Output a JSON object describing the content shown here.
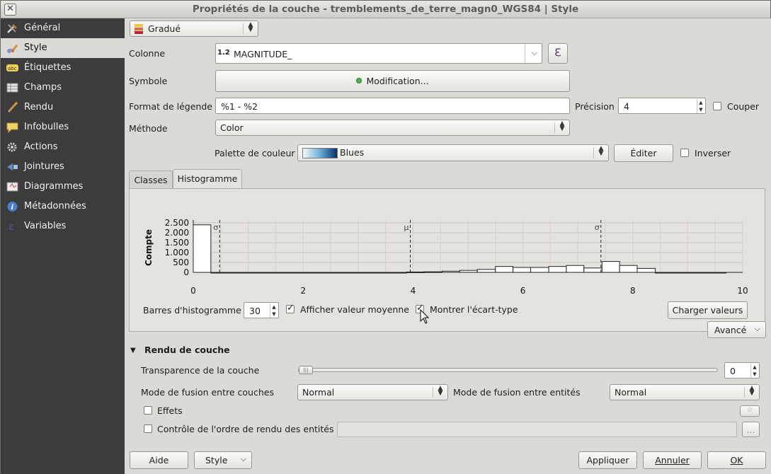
{
  "window": {
    "title": "Propriétés de la couche - tremblements_de_terre_magn0_WGS84 | Style"
  },
  "sidebar": {
    "items": [
      {
        "label": "Général",
        "icon": "tools-icon"
      },
      {
        "label": "Style",
        "icon": "paintbrush-icon",
        "active": true
      },
      {
        "label": "Étiquettes",
        "icon": "abc-label-icon"
      },
      {
        "label": "Champs",
        "icon": "table-icon"
      },
      {
        "label": "Rendu",
        "icon": "brush-icon"
      },
      {
        "label": "Infobulles",
        "icon": "speech-bubble-icon"
      },
      {
        "label": "Actions",
        "icon": "gear-icon"
      },
      {
        "label": "Jointures",
        "icon": "join-icon"
      },
      {
        "label": "Diagrammes",
        "icon": "diagram-icon"
      },
      {
        "label": "Métadonnées",
        "icon": "info-icon"
      },
      {
        "label": "Variables",
        "icon": "epsilon-icon"
      }
    ]
  },
  "renderer": {
    "value": "Gradué"
  },
  "column": {
    "label": "Colonne",
    "type_badge": "1.2",
    "value": "MAGNITUDE_",
    "expr_button": "ε"
  },
  "symbol": {
    "label": "Symbole",
    "button": "Modification..."
  },
  "legend_format": {
    "label": "Format de légende",
    "value": "%1 - %2"
  },
  "precision": {
    "label": "Précision",
    "value": "4"
  },
  "truncate": {
    "label": "Couper",
    "checked": false
  },
  "method": {
    "label": "Méthode",
    "value": "Color"
  },
  "color_ramp": {
    "label": "Palette de couleur",
    "value": "Blues",
    "edit_button": "Éditer",
    "invert_label": "Inverser",
    "invert_checked": false
  },
  "tabs": {
    "classes": "Classes",
    "histogram": "Histogramme",
    "active": "histogram"
  },
  "histogram": {
    "bars_label": "Barres d'histogramme",
    "bars_value": "30",
    "show_mean_label": "Afficher valeur moyenne",
    "show_mean_checked": true,
    "show_std_label": "Montrer l'écart-type",
    "show_std_checked": true,
    "load_button": "Charger valeurs"
  },
  "chart_data": {
    "type": "bar",
    "ylabel": "Compte",
    "xlabel": "",
    "xlim": [
      0,
      10
    ],
    "ylim": [
      0,
      2500
    ],
    "x_ticks": [
      "0",
      "2",
      "4",
      "6",
      "8",
      "10"
    ],
    "y_ticks": [
      "0",
      "500",
      "1.000",
      "1.500",
      "2.000",
      "2.500"
    ],
    "bin_edges": [
      0,
      0.32,
      0.65,
      0.97,
      1.29,
      1.62,
      1.94,
      2.26,
      2.59,
      2.91,
      3.23,
      3.56,
      3.88,
      4.2,
      4.53,
      4.85,
      5.17,
      5.5,
      5.82,
      6.14,
      6.47,
      6.79,
      7.11,
      7.44,
      7.76,
      8.08,
      8.41,
      8.73,
      9.05,
      9.38,
      9.7
    ],
    "values": [
      2400,
      0,
      0,
      0,
      0,
      0,
      0,
      0,
      0,
      0,
      0,
      0,
      20,
      30,
      60,
      100,
      150,
      300,
      250,
      250,
      300,
      350,
      220,
      550,
      350,
      200,
      0,
      0,
      0,
      0
    ],
    "markers": [
      {
        "label": "σ",
        "x": 0.48
      },
      {
        "label": "μ",
        "x": 3.95
      },
      {
        "label": "σ",
        "x": 7.42
      }
    ],
    "grid": true
  },
  "advanced_button": "Avancé",
  "layer_rendering": {
    "title": "Rendu de couche",
    "transparency_label": "Transparence de la couche",
    "transparency_value": "0",
    "blend_layers_label": "Mode de fusion entre couches",
    "blend_layers_value": "Normal",
    "blend_features_label": "Mode de fusion entre entités",
    "blend_features_value": "Normal",
    "effects_label": "Effets",
    "effects_checked": false,
    "order_label": "Contrôle de l'ordre de rendu des entités",
    "order_checked": false,
    "order_button": "..."
  },
  "footer": {
    "help": "Aide",
    "style": "Style",
    "apply": "Appliquer",
    "cancel": "Annuler",
    "ok": "OK"
  }
}
